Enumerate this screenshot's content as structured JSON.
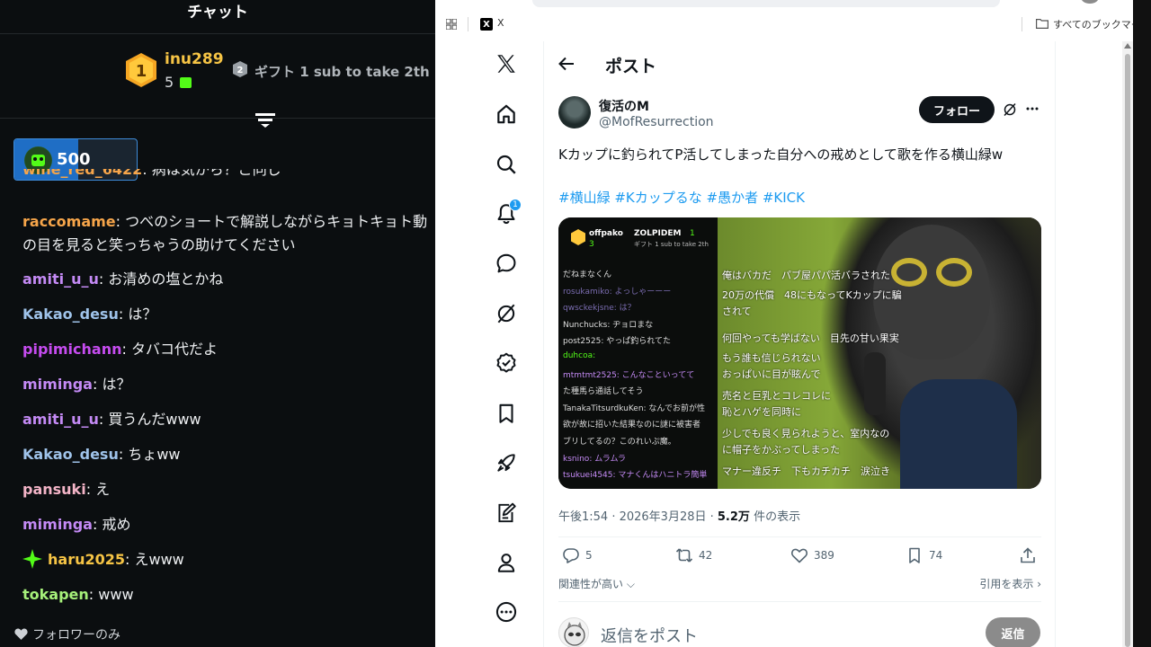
{
  "chat": {
    "title": "チャット",
    "leaderboard": {
      "first": {
        "rank": "1",
        "name": "inu289",
        "count": "5"
      },
      "second": {
        "rank": "2",
        "text": "ギフト 1 sub to take 2th"
      }
    },
    "pinned": {
      "value": "500",
      "progress": 0.52
    },
    "partial_line": {
      "user": "wine_red_6422",
      "text": "病は気から？ご同じ"
    },
    "messages": [
      {
        "user": "raccomame",
        "color": "#f6a54a",
        "text": "つべのショートで解説しながらキョトキョト動",
        "continuation": "の目を見ると笑っちゃうの助けてください"
      },
      {
        "user": "amiti_u_u",
        "color": "#c48af5",
        "text": "お清めの塩とかね"
      },
      {
        "user": "Kakao_desu",
        "color": "#9fc3ea",
        "text": "は？"
      },
      {
        "user": "pipimichann",
        "color": "#c64cf0",
        "text": "タバコ代だよ"
      },
      {
        "user": "miminga",
        "color": "#c48af5",
        "text": "は？"
      },
      {
        "user": "amiti_u_u",
        "color": "#c48af5",
        "text": "買うんだwww"
      },
      {
        "user": "Kakao_desu",
        "color": "#9fc3ea",
        "text": "ちょww"
      },
      {
        "user": "pansuki",
        "color": "#f3b4c7",
        "text": "え"
      },
      {
        "user": "miminga",
        "color": "#c48af5",
        "text": "戒め"
      },
      {
        "user": "haru2025",
        "color": "#f6c445",
        "text": "えwww",
        "badge": "star-icon"
      },
      {
        "user": "tokapen",
        "color": "#a6f07a",
        "text": "www"
      }
    ],
    "follower_only": "フォロワーのみ"
  },
  "browser": {
    "bookmark_x": "X",
    "bookmark_x_label": "X",
    "all_bookmarks": "すべてのブックマーク"
  },
  "xnav": {
    "notification_count": "1",
    "items": [
      "x-logo-icon",
      "home-icon",
      "search-icon",
      "bell-icon",
      "message-icon",
      "grok-icon",
      "verified-icon",
      "bookmark-icon",
      "rocket-icon",
      "edit-icon",
      "profile-icon",
      "more-circle-icon"
    ]
  },
  "post": {
    "header_title": "ポスト",
    "author_name": "復活のM",
    "author_handle": "@MofResurrection",
    "follow_label": "フォロー",
    "text": "Kカップに釣られてP活してしまった自分への戒めとして歌を作る横山緑w",
    "hashtags": "#横山緑 #Kカップるな #愚か者 #KICK",
    "media": {
      "chat_header_name": "offpako",
      "chat_header_second": "ZOLPIDEM",
      "chat_header_count": "3",
      "chat_header_count2": "1",
      "chat_gift": "ギフト 1 sub to take 2th",
      "chat_lines": [
        "だねまなくん",
        "rosukamiko: よっしゃーーー",
        "qwsckekjsne: は？",
        "Nunchucks: ヂョロまな",
        "post2525: やっぱ釣られてた",
        "duhcoa:",
        "mtmtmt2525: こんなこといってて",
        "た種馬ら通話してそう",
        "TanakaTitsurdkuKen: なんでお前が性",
        "欲が故に招いた結果なのに謎に被害者",
        "ブリしてるの？このれいぷ魔。",
        "ksnino: ムラムラ",
        "tsukuei4545: マナくんはハニトラ簡単"
      ],
      "lyrics": [
        "俺はバカだ　パブ屋パパ活バラされた",
        "20万の代償　48にもなってKカップに騙",
        "されて",
        "何回やっても学ばない　目先の甘い果実",
        "もう誰も信じられない",
        "おっぱいに目が眩んで",
        "売名と巨乳とコレコレに",
        "恥とハゲを同時に",
        "少しでも良く見られようと、室内なの",
        "に帽子をかぶってしまった",
        "マナー違反チ　下もカチカチ　涙泣き"
      ]
    },
    "time": "午後1:54 · 2026年3月28日 · ",
    "views": "5.2万",
    "views_label": "件の表示",
    "replies": "5",
    "reposts": "42",
    "likes": "389",
    "bookmarks": "74",
    "sort_label": "関連性が高い",
    "quotes_label": "引用を表示",
    "reply_placeholder": "返信をポスト",
    "reply_button": "返信"
  }
}
